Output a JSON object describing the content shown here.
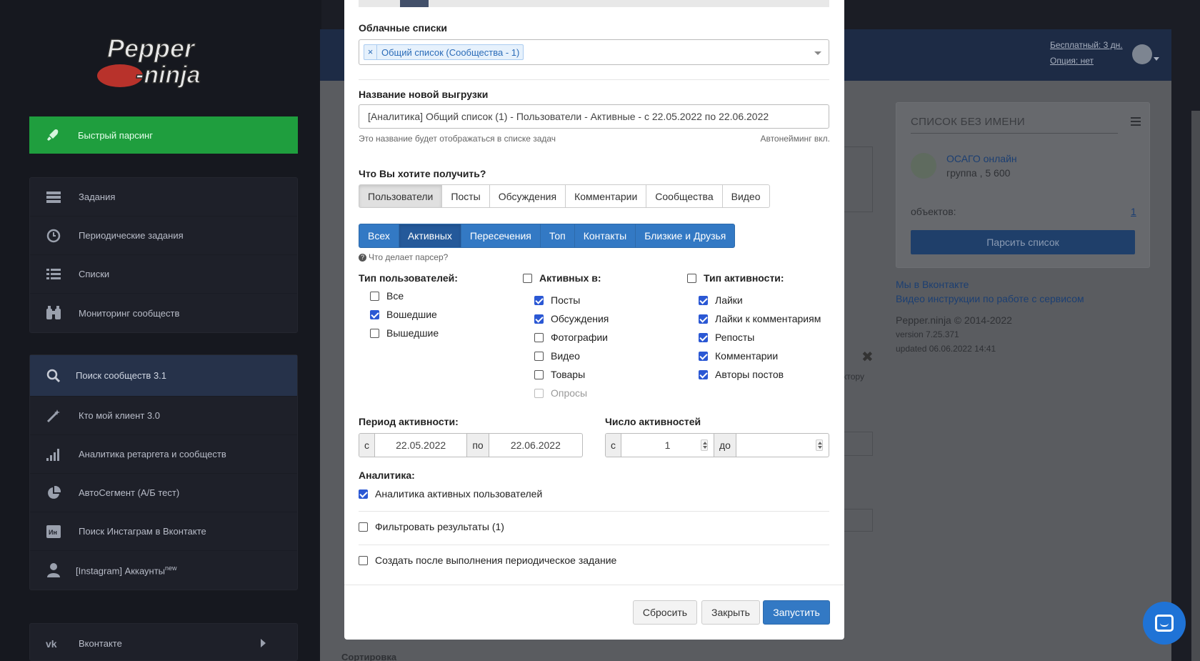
{
  "sidebar": {
    "logo_text": "Pepper ninja",
    "quick": {
      "label": "Быстрый парсинг",
      "icon": "rocket-icon"
    },
    "group1": [
      {
        "label": "Задания",
        "icon": "tasks-icon"
      },
      {
        "label": "Периодические задания",
        "icon": "clock-icon"
      },
      {
        "label": "Списки",
        "icon": "list-icon"
      },
      {
        "label": "Мониторинг сообществ",
        "icon": "binoculars-icon"
      }
    ],
    "group2": [
      {
        "label": "Поиск сообществ 3.1",
        "icon": "search-icon"
      },
      {
        "label": "Кто мой клиент 3.0",
        "icon": "magic-wand-icon"
      },
      {
        "label": "Аналитика ретаргета и сообществ",
        "icon": "signal-bars-icon"
      },
      {
        "label": "АвтоСегмент (А/Б тест)",
        "icon": "pie-chart-icon"
      },
      {
        "label": "Поиск Инстаграм в Вконтакте",
        "icon": "instagram-vk-icon"
      },
      {
        "label": "[Instagram] Аккаунты",
        "sup": "new",
        "icon": "user-icon"
      }
    ],
    "vk": {
      "label": "Вконтакте",
      "icon": "vk-icon"
    }
  },
  "header": {
    "plan": "Бесплатный: 3 дн.",
    "option": "Опция: нет"
  },
  "right_panel": {
    "title": "СПИСОК БЕЗ ИМЕНИ",
    "group_name": "ОСАГО онлайн",
    "group_sub": "группа , 5 600",
    "objects_label": "объектов:",
    "objects_count": "1",
    "parse_button": "Парсить список"
  },
  "right_links": {
    "vk_link": "Мы в Вконтакте",
    "video_link": "Видео инструкции по работе с сервисом",
    "copyright": "Pepper.ninja © 2014-2022",
    "version": "version 7.25.371",
    "updated": "updated 06.06.2022 14:41"
  },
  "background": {
    "fragment": "ктору",
    "sort": "Сортировка"
  },
  "modal": {
    "cloud_label": "Облачные списки",
    "cloud_tag": "Общий список (Сообщества - 1)",
    "name_label": "Название новой выгрузки",
    "name_value": "[Аналитика] Общий список (1) - Пользователи - Активные - с 22.05.2022 по 22.06.2022",
    "name_help": "Это название будет отображаться в списке задач",
    "autonaming": "Автонейминг вкл.",
    "want_label": "Что Вы хотите получить?",
    "type_tabs": [
      "Пользователи",
      "Посты",
      "Обсуждения",
      "Комментарии",
      "Сообщества",
      "Видео"
    ],
    "mode_tabs": [
      "Всех",
      "Активных",
      "Пересечения",
      "Топ",
      "Контакты",
      "Близкие и Друзья"
    ],
    "parser_help": "Что делает парсер?",
    "user_type_label": "Тип пользователей:",
    "user_types": [
      {
        "label": "Все",
        "checked": false
      },
      {
        "label": "Вошедшие",
        "checked": true
      },
      {
        "label": "Вышедшие",
        "checked": false
      }
    ],
    "active_in_label": "Активных в:",
    "active_in": [
      {
        "label": "Посты",
        "checked": true
      },
      {
        "label": "Обсуждения",
        "checked": true
      },
      {
        "label": "Фотографии",
        "checked": false
      },
      {
        "label": "Видео",
        "checked": false
      },
      {
        "label": "Товары",
        "checked": false
      },
      {
        "label": "Опросы",
        "checked": false,
        "disabled": true
      }
    ],
    "activity_type_label": "Тип активности:",
    "activity_types": [
      {
        "label": "Лайки",
        "checked": true
      },
      {
        "label": "Лайки к комментариям",
        "checked": true
      },
      {
        "label": "Репосты",
        "checked": true
      },
      {
        "label": "Комментарии",
        "checked": true
      },
      {
        "label": "Авторы постов",
        "checked": true
      }
    ],
    "period_label": "Период активности:",
    "period_from_prefix": "с",
    "period_from": "22.05.2022",
    "period_to_prefix": "по",
    "period_to": "22.06.2022",
    "count_label": "Число активностей",
    "count_from_prefix": "с",
    "count_from": "1",
    "count_to_prefix": "до",
    "count_to": "",
    "analytics_label": "Аналитика:",
    "analytics_check": "Аналитика активных пользователей",
    "filter_check": "Фильтровать результаты (1)",
    "periodic_check": "Создать после выполнения периодическое задание",
    "reset_button": "Сбросить",
    "close_button": "Закрыть",
    "run_button": "Запустить"
  },
  "colors": {
    "primary": "#3379c4",
    "quick_green": "#1f9e3e",
    "checkbox": "#2b58d4"
  }
}
